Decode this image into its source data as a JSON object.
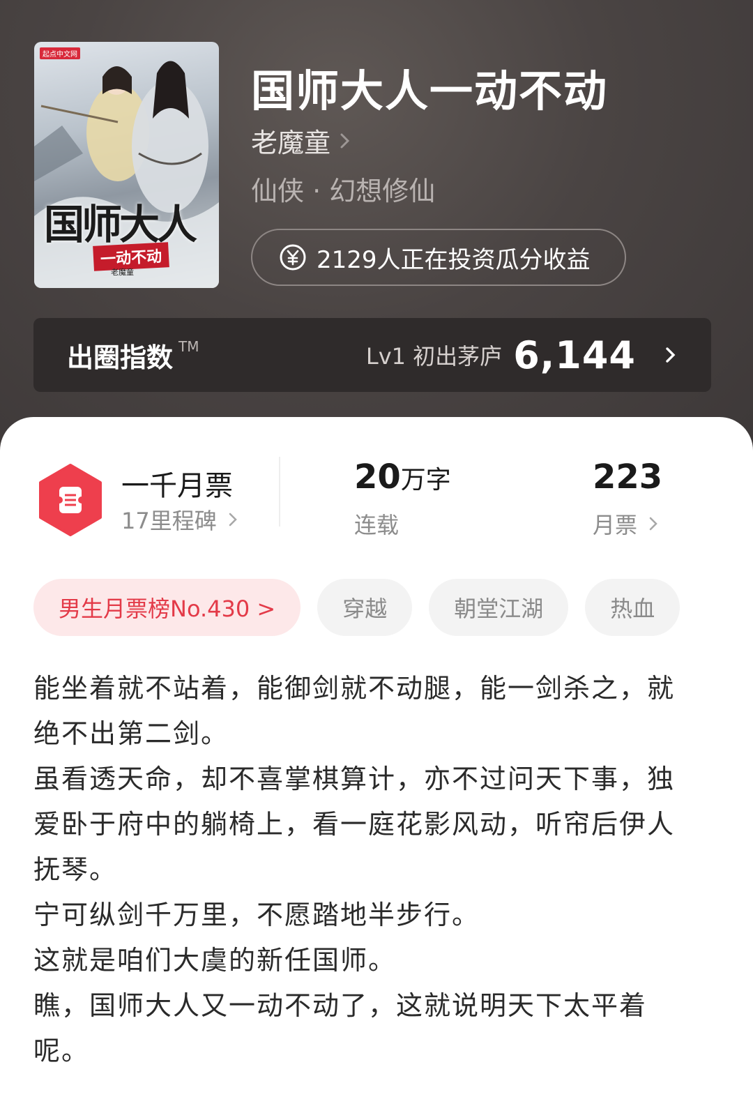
{
  "book": {
    "title": "国师大人一动不动",
    "author": "老魔童",
    "genre": "仙侠 · 幻想修仙",
    "invest_text": "2129人正在投资瓜分收益"
  },
  "cover": {
    "logo": "起点中文网",
    "title": "国师大人",
    "subtitle": "一动不动",
    "author": "老魔童"
  },
  "index": {
    "title": "出圈指数",
    "tm": "TM",
    "level": "Lv1 初出茅庐",
    "value": "6,144"
  },
  "stats": {
    "ticket_main": "一千月票",
    "ticket_sub": "17里程碑",
    "words_num": "20",
    "words_unit": "万字",
    "words_sub": "连载",
    "monthly_num": "223",
    "monthly_sub": "月票"
  },
  "tags": {
    "rank": "男生月票榜No.430 >",
    "items": [
      "穿越",
      "朝堂江湖",
      "热血"
    ]
  },
  "synopsis": [
    "能坐着就不站着，能御剑就不动腿，能一剑杀之，就绝不出第二剑。",
    "虽看透天命，却不喜掌棋算计，亦不过问天下事，独爱卧于府中的躺椅上，看一庭花影风动，听帘后伊人抚琴。",
    "宁可纵剑千万里，不愿踏地半步行。",
    "这就是咱们大虞的新任国师。",
    "瞧，国师大人又一动不动了，这就说明天下太平着呢。"
  ],
  "colors": {
    "header_bg": "#4a4443",
    "accent_red": "#e33a48",
    "rank_bg": "#fde8e9"
  }
}
